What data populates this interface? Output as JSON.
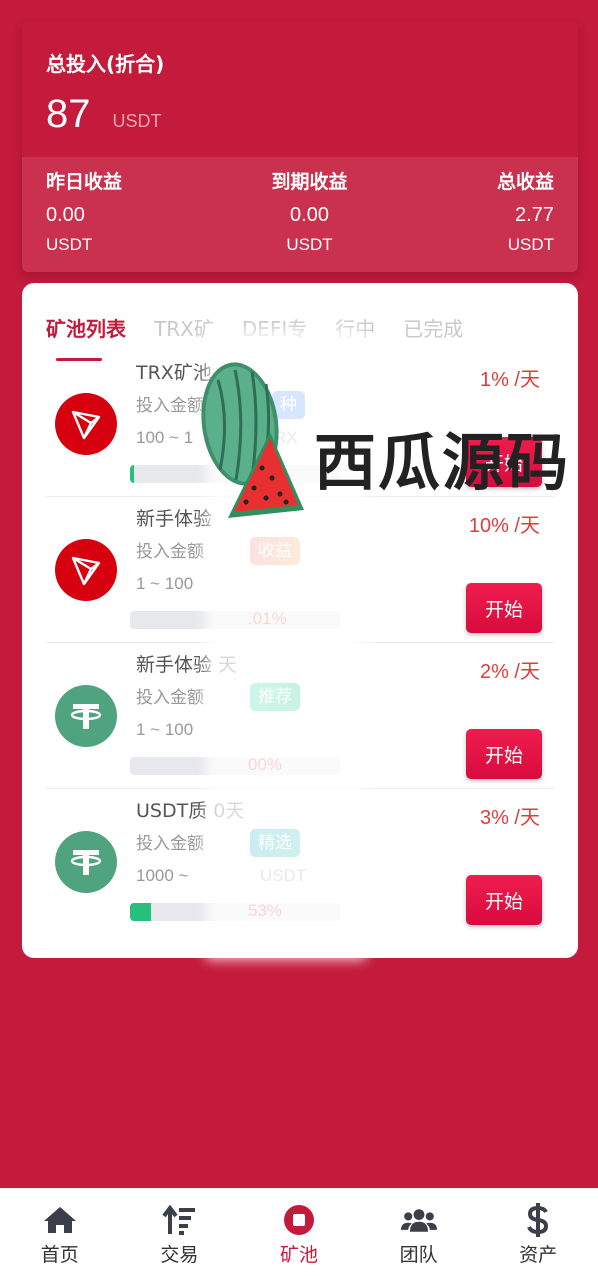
{
  "summary": {
    "title": "总投入(折合)",
    "value": "87",
    "unit": "USDT",
    "stats": [
      {
        "label": "昨日收益",
        "value": "0.00",
        "unit": "USDT"
      },
      {
        "label": "到期收益",
        "value": "0.00",
        "unit": "USDT"
      },
      {
        "label": "总收益",
        "value": "2.77",
        "unit": "USDT"
      }
    ]
  },
  "tabs": [
    {
      "label": "矿池列表",
      "active": true
    },
    {
      "label": "TRX矿",
      "active": false
    },
    {
      "label": "DEFI专",
      "active": false
    },
    {
      "label": "行中",
      "active": false
    },
    {
      "label": "已完成",
      "active": false
    }
  ],
  "pools": [
    {
      "name": "TRX矿池",
      "invest": "投入金额",
      "range": "100 ~ 1",
      "unit": "RX",
      "tag": "种",
      "rate": "1% /天",
      "progress_percent": "",
      "progress_fill": 0.02,
      "button": "开始",
      "coin": "trx-coin-icon"
    },
    {
      "name": "新手体验",
      "invest": "投入金额",
      "range": "1 ~ 100",
      "unit": "",
      "tag": "收益",
      "rate": "10% /天",
      "progress_percent": ".01%",
      "progress_fill": 0.0,
      "button": "开始",
      "coin": "trx-coin-icon"
    },
    {
      "name": "新手体验 天",
      "invest": "投入金额",
      "range": "1 ~ 100",
      "unit": "",
      "tag": "推荐",
      "rate": "2% /天",
      "progress_percent": "00%",
      "progress_fill": 0.0,
      "button": "开始",
      "coin": "usdt-coin-icon"
    },
    {
      "name": "USDT质 0天",
      "invest": "投入金额",
      "range": "1000 ~",
      "unit": "USDT",
      "tag": "精选",
      "rate": "3% /天",
      "progress_percent": "53%",
      "progress_fill": 0.1,
      "button": "开始",
      "coin": "usdt-coin-icon"
    }
  ],
  "watermark": {
    "text": "西瓜源码"
  },
  "nav": [
    {
      "label": "首页",
      "icon": "home-icon",
      "active": false
    },
    {
      "label": "交易",
      "icon": "sort-icon",
      "active": false
    },
    {
      "label": "矿池",
      "icon": "pool-icon",
      "active": true
    },
    {
      "label": "团队",
      "icon": "team-icon",
      "active": false
    },
    {
      "label": "资产",
      "icon": "dollar-icon",
      "active": false
    }
  ],
  "colors": {
    "brand": "#c41a3c",
    "rate": "#e23b3b",
    "trx": "#d7000f",
    "usdt": "#4fa37f"
  }
}
